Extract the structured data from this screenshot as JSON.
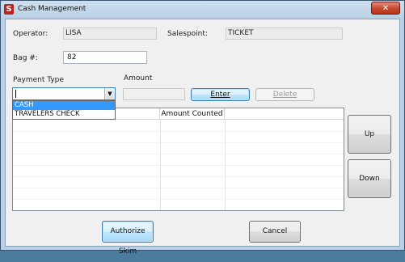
{
  "window": {
    "title": "Cash Management",
    "app_icon_letter": "S",
    "close_glyph": "✕"
  },
  "form": {
    "operator_label": "Operator:",
    "operator_value": "LISA",
    "salespoint_label": "Salespoint:",
    "salespoint_value": "TICKET",
    "bag_label": "Bag #:",
    "bag_value": "82",
    "payment_type_label": "Payment Type",
    "payment_type_value": "",
    "amount_label": "Amount",
    "amount_value": "",
    "dropdown_options": [
      "CASH",
      "TRAVELERS CHECK"
    ],
    "dropdown_selected_index": 0
  },
  "buttons": {
    "enter": "Enter",
    "delete": "Delete",
    "up": "Up",
    "down": "Down",
    "authorize_skim": "Authorize Skim",
    "cancel": "Cancel"
  },
  "grid": {
    "columns": [
      "",
      "Amount Counted",
      ""
    ],
    "rows": []
  },
  "icons": {
    "combo_arrow": "chevron-down-icon",
    "close": "close-icon"
  },
  "colors": {
    "title_bar": "#b9d0e4",
    "selection": "#3399ff",
    "close_button": "#c4472f"
  }
}
